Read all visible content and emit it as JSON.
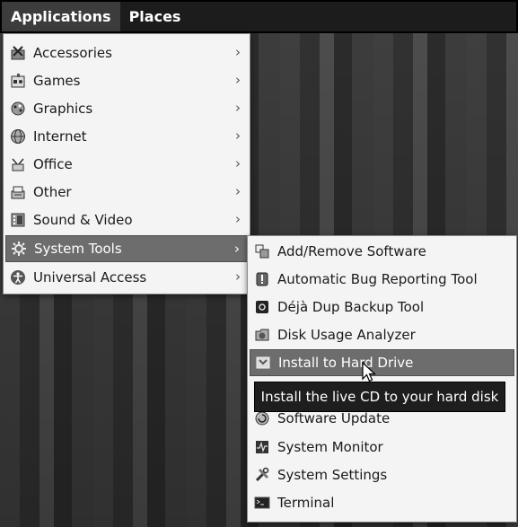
{
  "panel": {
    "applications_label": "Applications",
    "places_label": "Places"
  },
  "apps_menu": {
    "items": [
      {
        "label": "Accessories",
        "icon": "accessories-icon"
      },
      {
        "label": "Games",
        "icon": "games-icon"
      },
      {
        "label": "Graphics",
        "icon": "graphics-icon"
      },
      {
        "label": "Internet",
        "icon": "internet-icon"
      },
      {
        "label": "Office",
        "icon": "office-icon"
      },
      {
        "label": "Other",
        "icon": "other-icon"
      },
      {
        "label": "Sound & Video",
        "icon": "sound-video-icon"
      },
      {
        "label": "System Tools",
        "icon": "system-tools-icon",
        "highlighted": true
      },
      {
        "label": "Universal Access",
        "icon": "universal-access-icon"
      }
    ],
    "arrow": "›"
  },
  "systools_menu": {
    "items": [
      {
        "label": "Add/Remove Software",
        "icon": "add-remove-software-icon"
      },
      {
        "label": "Automatic Bug Reporting Tool",
        "icon": "bug-reporting-icon"
      },
      {
        "label": "Déjà Dup Backup Tool",
        "icon": "backup-icon"
      },
      {
        "label": "Disk Usage Analyzer",
        "icon": "disk-usage-icon"
      },
      {
        "label": "Install to Hard Drive",
        "icon": "install-icon",
        "highlighted": true
      },
      {
        "label": "Software Update",
        "icon": "software-update-icon"
      },
      {
        "label": "System Monitor",
        "icon": "system-monitor-icon"
      },
      {
        "label": "System Settings",
        "icon": "system-settings-icon"
      },
      {
        "label": "Terminal",
        "icon": "terminal-icon"
      }
    ]
  },
  "tooltip": {
    "text": "Install the live CD to your hard disk"
  },
  "colors": {
    "highlight": "#6d6d6d",
    "panel": "#1c1c1c",
    "menu_bg": "#f4f4f4"
  }
}
